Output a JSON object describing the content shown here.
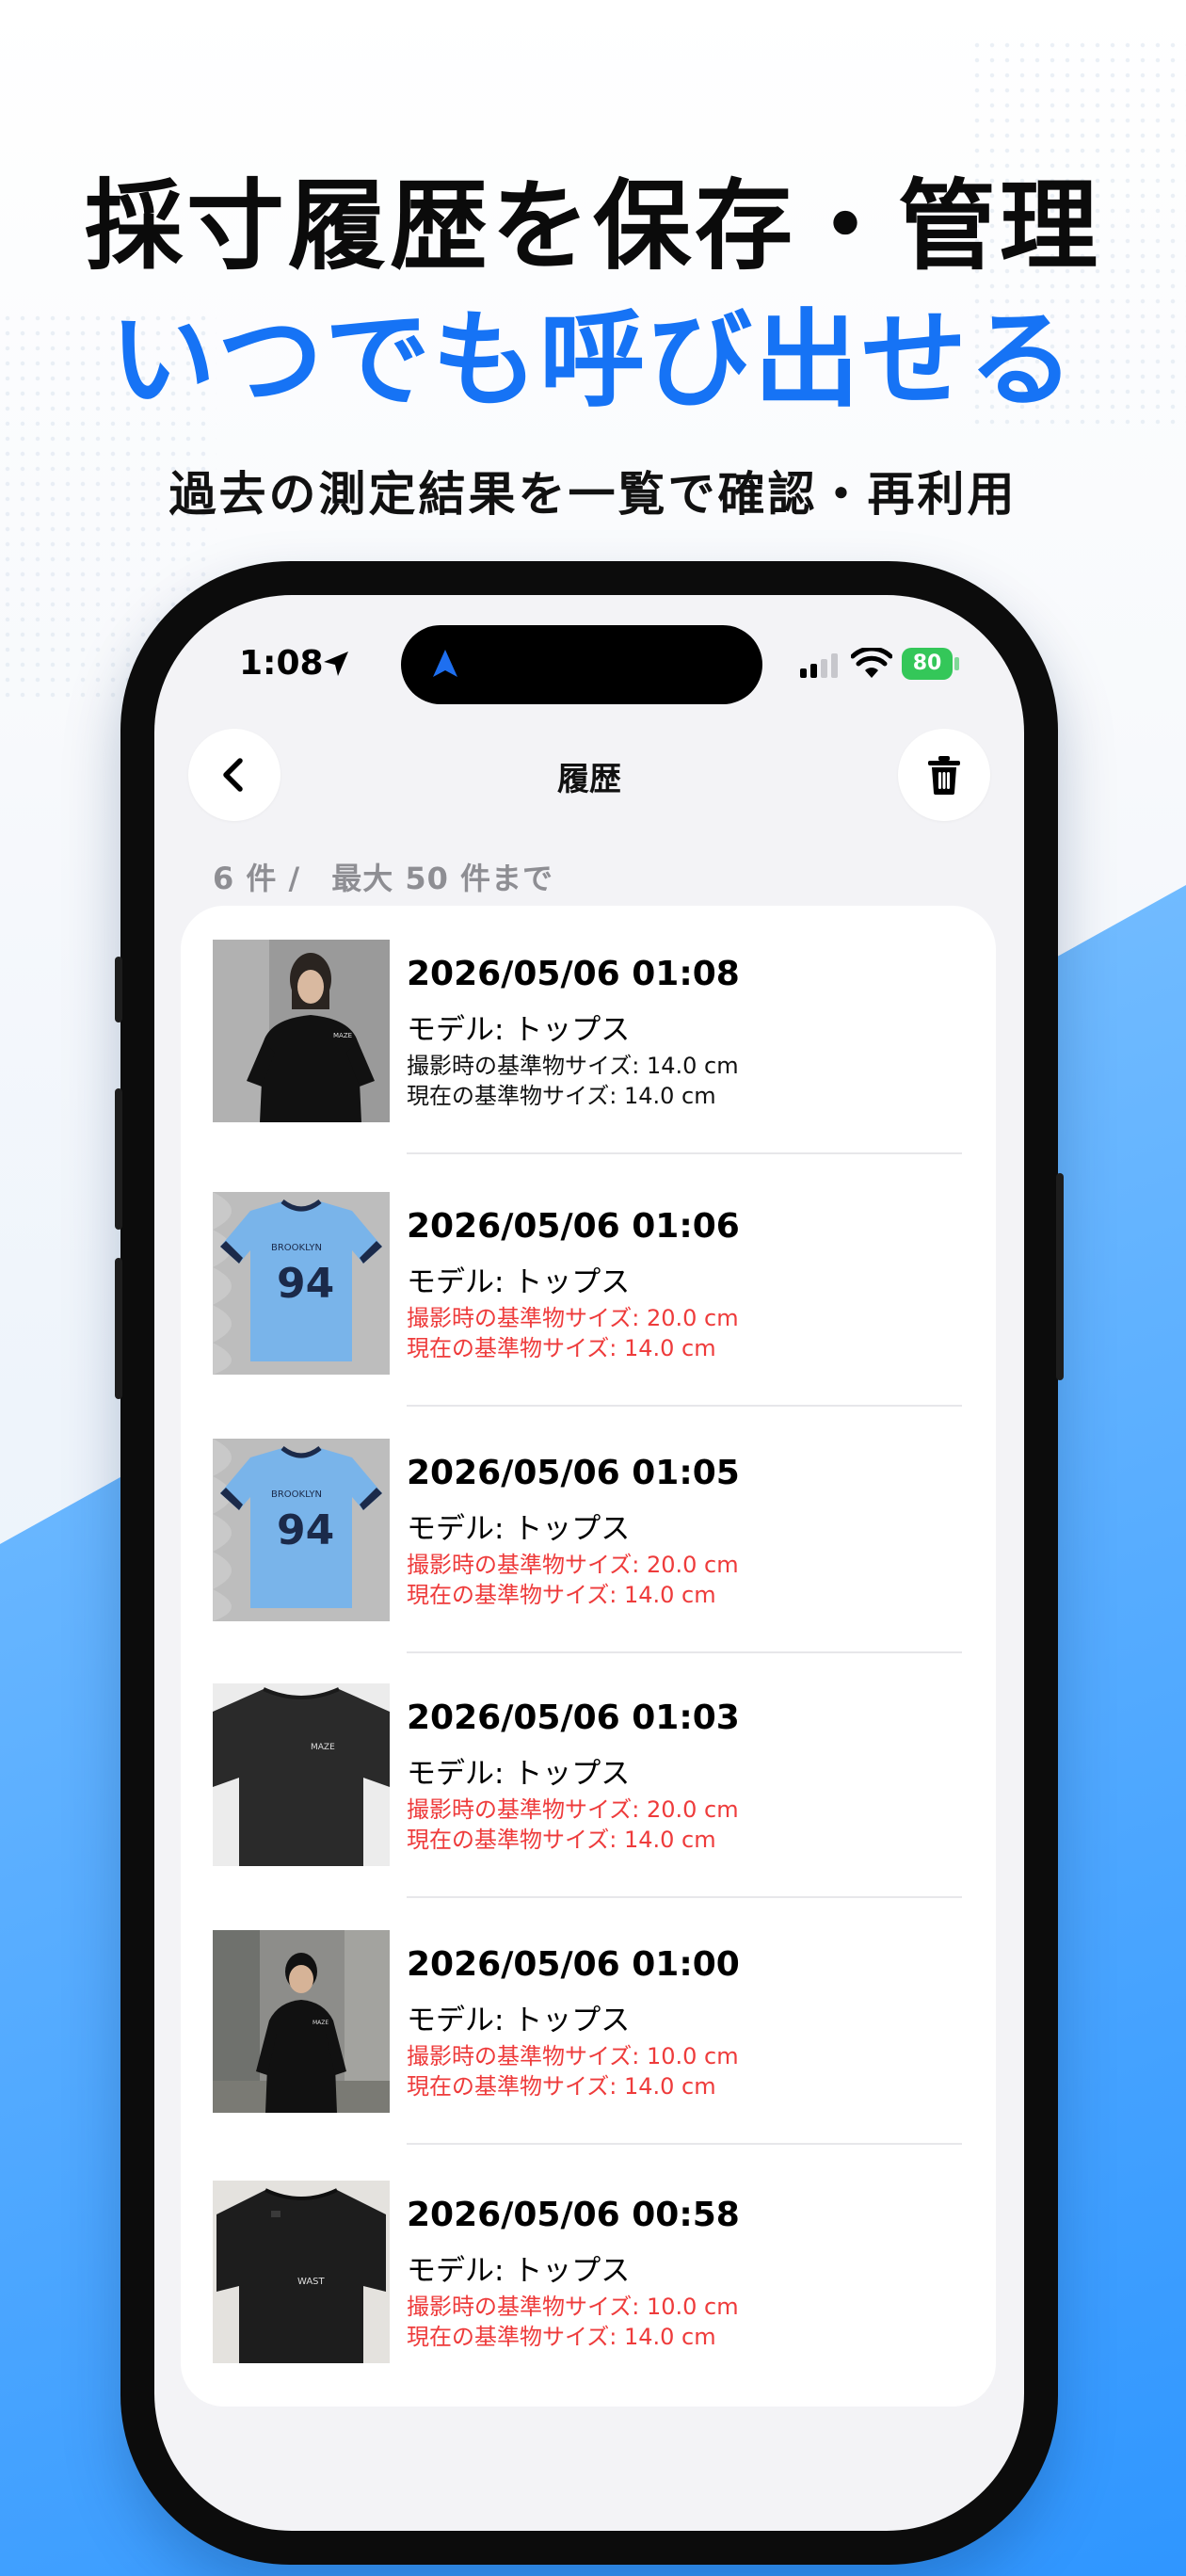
{
  "hero": {
    "line1": "採寸履歴を保存・管理",
    "line2": "いつでも呼び出せる",
    "line3": "過去の測定結果を一覧で確認・再利用"
  },
  "status_bar": {
    "time": "1:08",
    "battery": "80"
  },
  "nav": {
    "title": "履歴",
    "back_icon": "chevron-left-icon",
    "delete_icon": "trash-icon"
  },
  "count_label": "6 件 /　最大 50 件まで",
  "colors": {
    "accent_blue": "#1673f5",
    "warning_red": "#ee3b3b",
    "battery_green": "#34c759"
  },
  "history": [
    {
      "datetime": "2026/05/06 01:08",
      "model": "モデル: トップス",
      "captured_size": "撮影時の基準物サイズ: 14.0 cm",
      "current_size": "現在の基準物サイズ: 14.0 cm",
      "mismatch": false,
      "thumbnail": "person-black-tee"
    },
    {
      "datetime": "2026/05/06 01:06",
      "model": "モデル: トップス",
      "captured_size": "撮影時の基準物サイズ: 20.0 cm",
      "current_size": "現在の基準物サイズ: 14.0 cm",
      "mismatch": true,
      "thumbnail": "blue-jersey-94"
    },
    {
      "datetime": "2026/05/06 01:05",
      "model": "モデル: トップス",
      "captured_size": "撮影時の基準物サイズ: 20.0 cm",
      "current_size": "現在の基準物サイズ: 14.0 cm",
      "mismatch": true,
      "thumbnail": "blue-jersey-94"
    },
    {
      "datetime": "2026/05/06 01:03",
      "model": "モデル: トップス",
      "captured_size": "撮影時の基準物サイズ: 20.0 cm",
      "current_size": "現在の基準物サイズ: 14.0 cm",
      "mismatch": true,
      "thumbnail": "black-tee-flat"
    },
    {
      "datetime": "2026/05/06 01:00",
      "model": "モデル: トップス",
      "captured_size": "撮影時の基準物サイズ: 10.0 cm",
      "current_size": "現在の基準物サイズ: 14.0 cm",
      "mismatch": true,
      "thumbnail": "person-black-tee-outdoor"
    },
    {
      "datetime": "2026/05/06 00:58",
      "model": "モデル: トップス",
      "captured_size": "撮影時の基準物サイズ: 10.0 cm",
      "current_size": "現在の基準物サイズ: 14.0 cm",
      "mismatch": true,
      "thumbnail": "black-tee-hanging"
    }
  ]
}
